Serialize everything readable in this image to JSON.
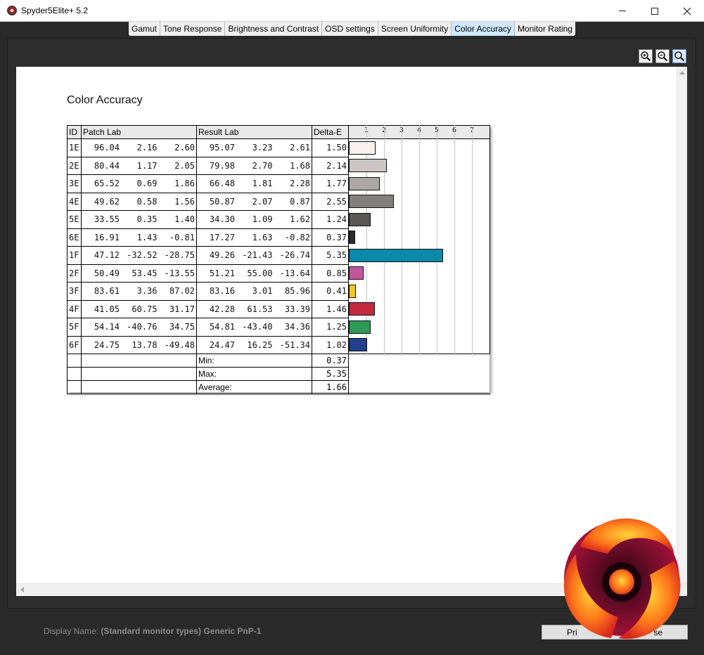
{
  "window": {
    "title": "Spyder5Elite+ 5.2"
  },
  "tabs": [
    {
      "label": "Gamut",
      "active": false
    },
    {
      "label": "Tone Response",
      "active": false
    },
    {
      "label": "Brightness and Contrast",
      "active": false
    },
    {
      "label": "OSD settings",
      "active": false
    },
    {
      "label": "Screen Uniformity",
      "active": false
    },
    {
      "label": "Color Accuracy",
      "active": true
    },
    {
      "label": "Monitor Rating",
      "active": false
    }
  ],
  "zoom": {
    "icons": [
      "zoom-in-icon",
      "zoom-out-icon",
      "zoom-fit-icon"
    ]
  },
  "report": {
    "title": "Color Accuracy",
    "headers": {
      "id": "ID",
      "patch": "Patch Lab",
      "result": "Result Lab",
      "delta": "Delta-E"
    },
    "scale_ticks": [
      "1",
      "2",
      "3",
      "4",
      "5",
      "6",
      "7"
    ],
    "scale_max": 8,
    "rows": [
      {
        "id": "1E",
        "patch": [
          "96.04",
          "2.16",
          "2.60"
        ],
        "result": [
          "95.07",
          "3.23",
          "2.61"
        ],
        "delta": "1.50",
        "value": 1.5,
        "color": "#f8f1ee"
      },
      {
        "id": "2E",
        "patch": [
          "80.44",
          "1.17",
          "2.05"
        ],
        "result": [
          "79.98",
          "2.70",
          "1.68"
        ],
        "delta": "2.14",
        "value": 2.14,
        "color": "#cbc6c5"
      },
      {
        "id": "3E",
        "patch": [
          "65.52",
          "0.69",
          "1.86"
        ],
        "result": [
          "66.48",
          "1.81",
          "2.28"
        ],
        "delta": "1.77",
        "value": 1.77,
        "color": "#aaa7a6"
      },
      {
        "id": "4E",
        "patch": [
          "49.62",
          "0.58",
          "1.56"
        ],
        "result": [
          "50.87",
          "2.07",
          "0.87"
        ],
        "delta": "2.55",
        "value": 2.55,
        "color": "#858080"
      },
      {
        "id": "5E",
        "patch": [
          "33.55",
          "0.35",
          "1.40"
        ],
        "result": [
          "34.30",
          "1.09",
          "1.62"
        ],
        "delta": "1.24",
        "value": 1.24,
        "color": "#5a5757"
      },
      {
        "id": "6E",
        "patch": [
          "16.91",
          "1.43",
          "-0.81"
        ],
        "result": [
          "17.27",
          "1.63",
          "-0.82"
        ],
        "delta": "0.37",
        "value": 0.37,
        "color": "#2c2b2b"
      },
      {
        "id": "1F",
        "patch": [
          "47.12",
          "-32.52",
          "-28.75"
        ],
        "result": [
          "49.26",
          "-21.43",
          "-26.74"
        ],
        "delta": "5.35",
        "value": 5.35,
        "color": "#0a89a8"
      },
      {
        "id": "2F",
        "patch": [
          "50.49",
          "53.45",
          "-13.55"
        ],
        "result": [
          "51.21",
          "55.00",
          "-13.64"
        ],
        "delta": "0.85",
        "value": 0.85,
        "color": "#c5559a"
      },
      {
        "id": "3F",
        "patch": [
          "83.61",
          "3.36",
          "87.02"
        ],
        "result": [
          "83.16",
          "3.01",
          "85.96"
        ],
        "delta": "0.41",
        "value": 0.41,
        "color": "#f1c62a"
      },
      {
        "id": "4F",
        "patch": [
          "41.05",
          "60.75",
          "31.17"
        ],
        "result": [
          "42.28",
          "61.53",
          "33.39"
        ],
        "delta": "1.46",
        "value": 1.46,
        "color": "#c32a3f"
      },
      {
        "id": "5F",
        "patch": [
          "54.14",
          "-40.76",
          "34.75"
        ],
        "result": [
          "54.81",
          "-43.40",
          "34.36"
        ],
        "delta": "1.25",
        "value": 1.25,
        "color": "#2f9a55"
      },
      {
        "id": "6F",
        "patch": [
          "24.75",
          "13.78",
          "-49.48"
        ],
        "result": [
          "24.47",
          "16.25",
          "-51.34"
        ],
        "delta": "1.02",
        "value": 1.02,
        "color": "#243f8c"
      }
    ],
    "summary": [
      {
        "label": "Min:",
        "value": "0.37"
      },
      {
        "label": "Max:",
        "value": "5.35"
      },
      {
        "label": "Average:",
        "value": "1.66"
      }
    ]
  },
  "footer": {
    "display_label": "Display Name:",
    "display_value": "(Standard monitor types) Generic PnP-1",
    "print_label_partial": "Pri",
    "close_label_partial": "se"
  },
  "chart_data": {
    "type": "bar",
    "title": "Color Accuracy",
    "xlabel": "Delta-E",
    "categories": [
      "1E",
      "2E",
      "3E",
      "4E",
      "5E",
      "6E",
      "1F",
      "2F",
      "3F",
      "4F",
      "5F",
      "6F"
    ],
    "values": [
      1.5,
      2.14,
      1.77,
      2.55,
      1.24,
      0.37,
      5.35,
      0.85,
      0.41,
      1.46,
      1.25,
      1.02
    ],
    "xlim": [
      0,
      8
    ],
    "ticks": [
      1,
      2,
      3,
      4,
      5,
      6,
      7
    ],
    "orientation": "horizontal",
    "grid": true
  }
}
